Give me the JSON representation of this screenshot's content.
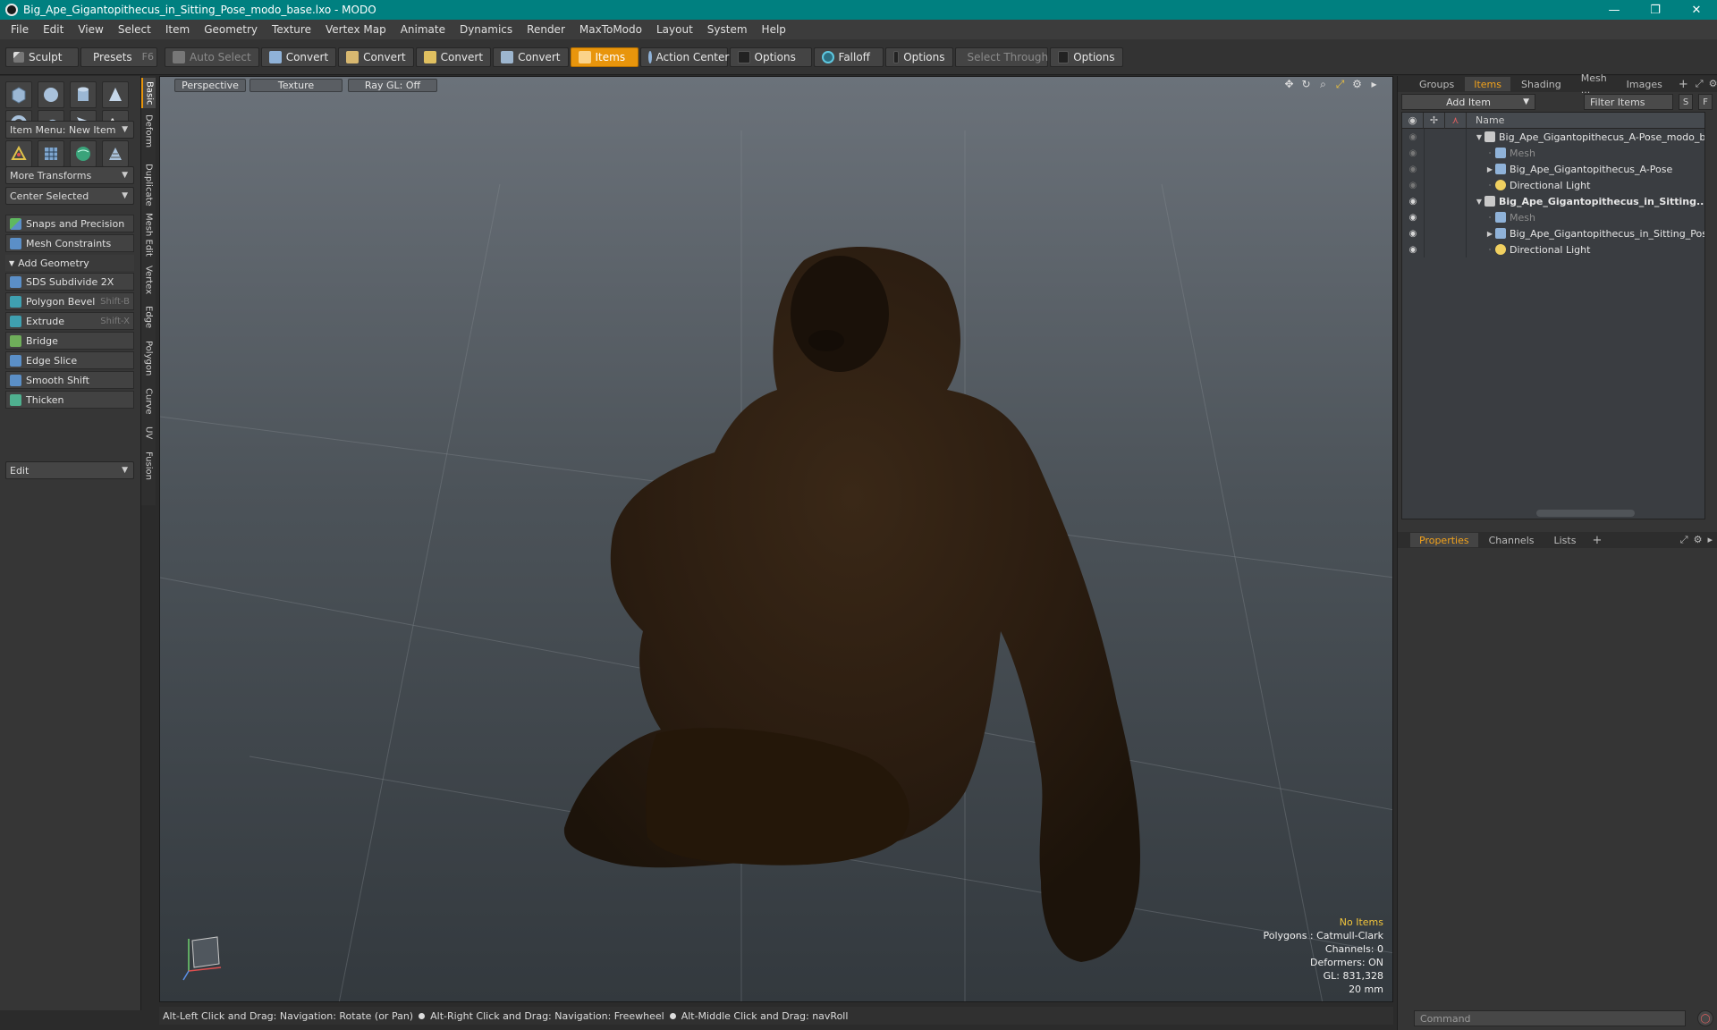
{
  "window": {
    "title": "Big_Ape_Gigantopithecus_in_Sitting_Pose_modo_base.lxo - MODO",
    "minimize": "—",
    "maximize": "❐",
    "close": "✕"
  },
  "menu": [
    "File",
    "Edit",
    "View",
    "Select",
    "Item",
    "Geometry",
    "Texture",
    "Vertex Map",
    "Animate",
    "Dynamics",
    "Render",
    "MaxToModo",
    "Layout",
    "System",
    "Help"
  ],
  "toolbar": {
    "sculpt": "Sculpt",
    "presets": "Presets",
    "presets_key": "F6",
    "auto_select": "Auto Select",
    "convert": "Convert",
    "items": "Items",
    "action_center": "Action Center",
    "options": "Options",
    "falloff": "Falloff",
    "select_through": "Select Through"
  },
  "leftpanel": {
    "item_menu": "Item Menu: New Item",
    "more_transforms": "More Transforms",
    "center_selected": "Center Selected",
    "snaps": "Snaps and Precision",
    "mesh_constraints": "Mesh Constraints",
    "add_geometry": "Add Geometry",
    "tools": [
      {
        "label": "SDS Subdivide 2X",
        "shortcut": "",
        "color": "#5b8fc7"
      },
      {
        "label": "Polygon Bevel",
        "shortcut": "Shift-B",
        "color": "#3fa0b0"
      },
      {
        "label": "Extrude",
        "shortcut": "Shift-X",
        "color": "#3fa0b0"
      },
      {
        "label": "Bridge",
        "shortcut": "",
        "color": "#6fae5a"
      },
      {
        "label": "Edge Slice",
        "shortcut": "",
        "color": "#5b8fc7"
      },
      {
        "label": "Smooth Shift",
        "shortcut": "",
        "color": "#5b8fc7"
      },
      {
        "label": "Thicken",
        "shortcut": "",
        "color": "#4fb08f"
      }
    ],
    "edit": "Edit"
  },
  "vtabs": [
    "Basic",
    "Deform",
    "Duplicate",
    "Mesh Edit",
    "Vertex",
    "Edge",
    "Polygon",
    "Curve",
    "UV",
    "Fusion"
  ],
  "viewport": {
    "perspective": "Perspective",
    "texture": "Texture",
    "raygl": "Ray GL: Off",
    "info": {
      "no_items": "No Items",
      "polygons": "Polygons : Catmull-Clark",
      "channels": "Channels: 0",
      "deformers": "Deformers: ON",
      "gl": "GL: 831,328",
      "size": "20 mm"
    }
  },
  "status": {
    "hint1": "Alt-Left Click and Drag: Navigation: Rotate (or Pan)",
    "hint2": "Alt-Right Click and Drag: Navigation: Freewheel",
    "hint3": "Alt-Middle Click and Drag: navRoll"
  },
  "rightpanel": {
    "tabs": [
      "Groups",
      "Items",
      "Shading",
      "Mesh ...",
      "Images"
    ],
    "add_item": "Add Item",
    "filter_items": "Filter Items",
    "s_btn": "S",
    "f_btn": "F",
    "name_col": "Name",
    "tree": [
      {
        "label": "Big_Ape_Gigantopithecus_A-Pose_modo_b...",
        "indent": 0,
        "exp": "▼",
        "icon": "scene",
        "style": "normal",
        "eye": "eye-dim"
      },
      {
        "label": "Mesh",
        "indent": 1,
        "exp": "",
        "icon": "mesh",
        "style": "dim",
        "eye": "eye-dim"
      },
      {
        "label": "Big_Ape_Gigantopithecus_A-Pose",
        "indent": 1,
        "exp": "▶",
        "icon": "mesh",
        "style": "normal",
        "eye": "eye-dim"
      },
      {
        "label": "Directional Light",
        "indent": 1,
        "exp": "",
        "icon": "light",
        "style": "normal",
        "eye": "eye-dim"
      },
      {
        "label": "Big_Ape_Gigantopithecus_in_Sitting...",
        "indent": 0,
        "exp": "▼",
        "icon": "scene",
        "style": "bold",
        "eye": "eye"
      },
      {
        "label": "Mesh",
        "indent": 1,
        "exp": "",
        "icon": "mesh",
        "style": "dim",
        "eye": "eye"
      },
      {
        "label": "Big_Ape_Gigantopithecus_in_Sitting_Pose",
        "indent": 1,
        "exp": "▶",
        "icon": "mesh",
        "style": "normal",
        "eye": "eye"
      },
      {
        "label": "Directional Light",
        "indent": 1,
        "exp": "",
        "icon": "light",
        "style": "normal",
        "eye": "eye"
      }
    ],
    "prop_tabs": [
      "Properties",
      "Channels",
      "Lists"
    ],
    "command": "Command"
  },
  "colors": {
    "accent": "#e8950c",
    "titlebar": "#008080"
  }
}
